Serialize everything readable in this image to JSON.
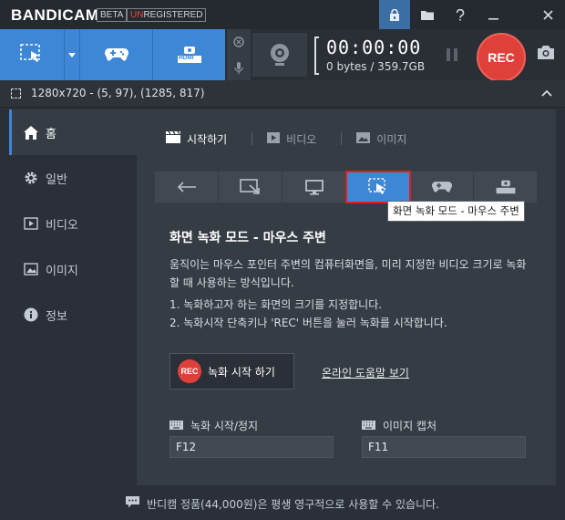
{
  "app": {
    "logo": "BANDICAM",
    "beta": "BETA",
    "unreg_prefix": "UN",
    "unreg_rest": "REGISTERED"
  },
  "titlebar": {
    "icons": [
      "lock-icon",
      "folder-icon",
      "help-icon",
      "minimize-icon",
      "close-icon"
    ]
  },
  "toolbar": {
    "modes": [
      "screen-rectangle",
      "game",
      "hdmi"
    ],
    "hdmi_label": "HDMI",
    "timer": "00:00:00",
    "size": "0 bytes / 359.7GB",
    "rec_label": "REC"
  },
  "infobar": {
    "text": "1280x720 - (5, 97), (1285, 817)"
  },
  "sidebar": {
    "items": [
      {
        "label": "홈",
        "icon": "home-icon"
      },
      {
        "label": "일반",
        "icon": "gear-icon"
      },
      {
        "label": "비디오",
        "icon": "video-icon"
      },
      {
        "label": "이미지",
        "icon": "image-icon"
      },
      {
        "label": "정보",
        "icon": "info-icon"
      }
    ]
  },
  "main": {
    "tabs": [
      {
        "label": "시작하기",
        "icon": "clapper-icon"
      },
      {
        "label": "비디오",
        "icon": "play-icon"
      },
      {
        "label": "이미지",
        "icon": "image-icon"
      }
    ],
    "tooltip": "화면 녹화 모드 - 마우스 주변",
    "title": "화면 녹화 모드 - 마우스 주변",
    "desc": "움직이는 마우스 포인터 주변의 컴퓨터화면을, 미리 지정한 비디오 크기로 녹화할 때 사용하는 방식입니다.",
    "step1": "1. 녹화하고자 하는 화면의 크기를 지정합니다.",
    "step2": "2. 녹화시작 단축키나 'REC' 버튼을 눌러 녹화를 시작합니다.",
    "rec_button": "녹화 시작 하기",
    "rec_dot": "REC",
    "help_link": "온라인 도움말 보기",
    "hotkey_record_label": "녹화 시작/정지",
    "hotkey_record_value": "F12",
    "hotkey_capture_label": "이미지 캡처",
    "hotkey_capture_value": "F11"
  },
  "status": {
    "text": "반디캠 정품(44,000원)은 평생 영구적으로 사용할 수 있습니다."
  },
  "colors": {
    "accent": "#3d87d6",
    "rec": "#e0403a",
    "highlight": "#e01f1f"
  }
}
